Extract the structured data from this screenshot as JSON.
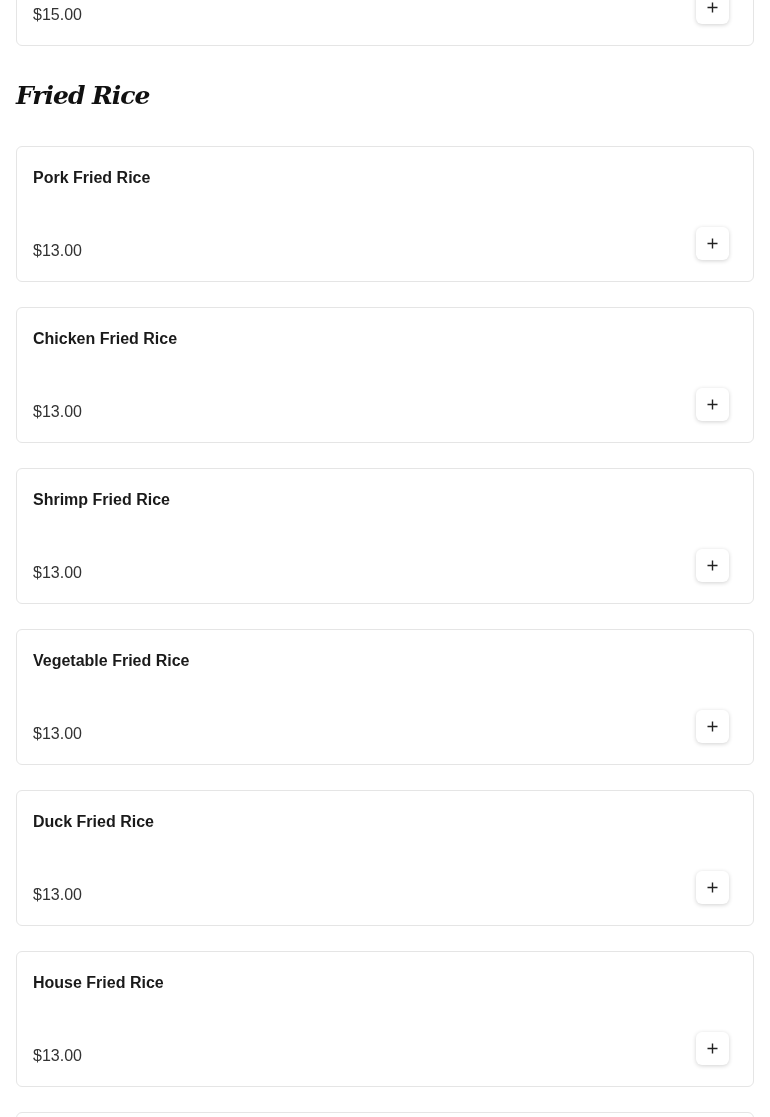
{
  "previous_item": {
    "price": "$15.00"
  },
  "section": {
    "title": "Fried Rice",
    "items": [
      {
        "name": "Pork Fried Rice",
        "price": "$13.00"
      },
      {
        "name": "Chicken Fried Rice",
        "price": "$13.00"
      },
      {
        "name": "Shrimp Fried Rice",
        "price": "$13.00"
      },
      {
        "name": "Vegetable Fried Rice",
        "price": "$13.00"
      },
      {
        "name": "Duck Fried Rice",
        "price": "$13.00"
      },
      {
        "name": "House Fried Rice",
        "price": "$13.00"
      }
    ]
  }
}
